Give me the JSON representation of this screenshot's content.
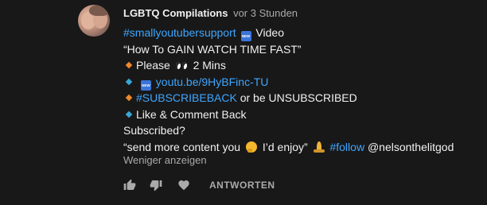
{
  "comment": {
    "author": "LGBTQ Compilations",
    "time": "vor 3 Stunden",
    "lines": {
      "l1_hashtag": "#smallyoutubersupport",
      "l1_text": "Video",
      "l2_text": "“How To GAIN WATCH TIME FAST”",
      "l3_text_a": "Please",
      "l3_text_b": "2 Mins",
      "l4_link": "youtu.be/9HyBFinc-TU",
      "l5_hashtag": "#SUBSCRIBEBACK",
      "l5_text": "or be UNSUBSCRIBED",
      "l6_text": "Like & Comment Back",
      "l7_text": "Subscribed?",
      "l8_text_a": "“send more content you",
      "l8_text_b": "I’d enjoy”",
      "l8_hashtag": "#follow",
      "l8_mention": "@nelsonthelitgod"
    },
    "new_badge": "NEW",
    "less_label": "Weniger anzeigen",
    "reply_label": "ANTWORTEN"
  },
  "colors": {
    "background": "#181818",
    "text": "#f1f1f1",
    "muted": "#aaaaaa",
    "link": "#3ea6ff",
    "new_badge": "#3b74d9",
    "orange_diamond": "#f0882b",
    "blue_diamond": "#38a8d8"
  },
  "icons": {
    "like": "thumbs-up-icon",
    "dislike": "thumbs-down-icon",
    "heart": "heart-icon",
    "eyes": "eyes-emoji-icon",
    "thinking": "thinking-face-emoji-icon",
    "pray": "folded-hands-emoji-icon"
  }
}
